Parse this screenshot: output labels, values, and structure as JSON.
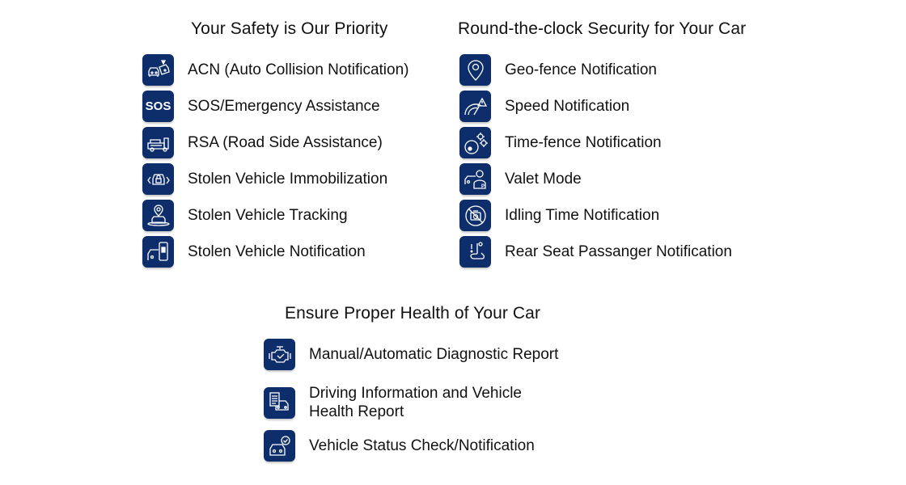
{
  "sections": [
    {
      "title": "Your Safety is Our Priority",
      "items": [
        {
          "label": "ACN (Auto Collision Notification)",
          "icon": "car-collision-icon"
        },
        {
          "label": "SOS/Emergency Assistance",
          "icon": "sos-icon",
          "icon_text": "SOS"
        },
        {
          "label": "RSA (Road Side Assistance)",
          "icon": "tow-truck-icon"
        },
        {
          "label": "Stolen Vehicle Immobilization",
          "icon": "car-lock-icon"
        },
        {
          "label": "Stolen Vehicle Tracking",
          "icon": "car-location-pin-icon"
        },
        {
          "label": "Stolen Vehicle Notification",
          "icon": "car-phone-alert-icon"
        }
      ]
    },
    {
      "title": "Round-the-clock Security for Your Car",
      "items": [
        {
          "label": "Geo-fence Notification",
          "icon": "location-pin-icon"
        },
        {
          "label": "Speed Notification",
          "icon": "speedometer-warning-icon"
        },
        {
          "label": "Time-fence Notification",
          "icon": "gears-clock-icon"
        },
        {
          "label": "Valet Mode",
          "icon": "valet-parking-icon"
        },
        {
          "label": "Idling Time Notification",
          "icon": "engine-timer-icon"
        },
        {
          "label": "Rear Seat Passanger Notification",
          "icon": "seat-alert-icon"
        }
      ]
    },
    {
      "title": "Ensure Proper Health of Your Car",
      "items": [
        {
          "label": "Manual/Automatic Diagnostic Report",
          "icon": "engine-check-icon"
        },
        {
          "label": "Driving Information and Vehicle Health Report",
          "icon": "car-report-icon"
        },
        {
          "label": "Vehicle Status Check/Notification",
          "icon": "car-check-icon"
        }
      ]
    }
  ],
  "colors": {
    "icon_bg": "#0d2e6b",
    "icon_fg": "#ffffff",
    "text": "#111111"
  }
}
